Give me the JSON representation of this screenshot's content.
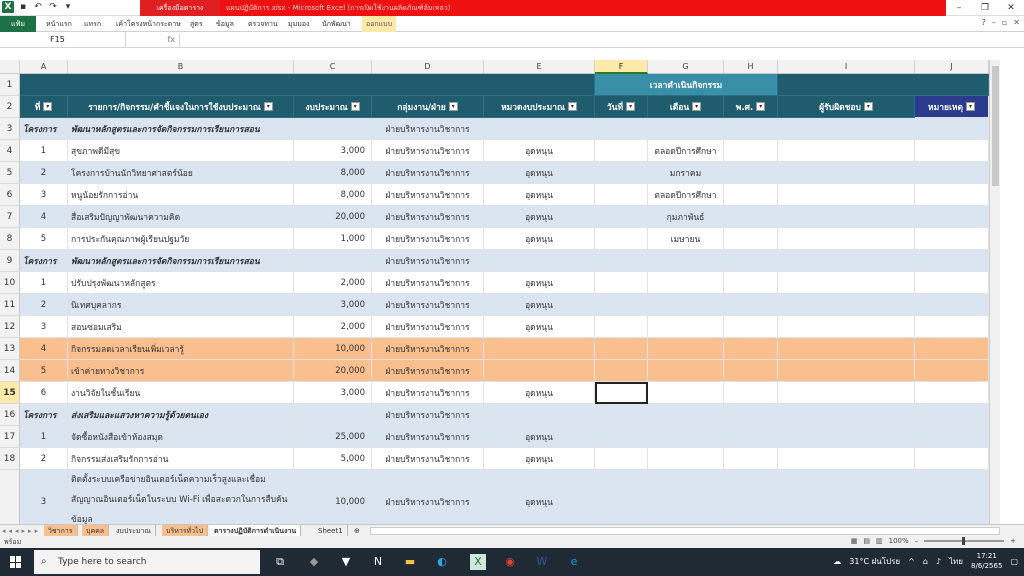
{
  "app": {
    "context_tab": "เครื่องมือตาราง",
    "window_title": "แผนปฏิบัติการ.xlsx - Microsoft Excel (การเปิดใช้งานผลิตภัณฑ์ล้มเหลว)",
    "ribbon_tabs": [
      "แฟ้ม",
      "หน้าแรก",
      "แทรก",
      "เค้าโครงหน้ากระดาษ",
      "สูตร",
      "ข้อมูล",
      "ตรวจทาน",
      "มุมมอง",
      "นักพัฒนา",
      "ออกแบบ"
    ]
  },
  "formula_bar": {
    "name_box": "F15",
    "fx": "fx",
    "value": ""
  },
  "columns": [
    "A",
    "B",
    "C",
    "D",
    "E",
    "F",
    "G",
    "H",
    "I",
    "J"
  ],
  "selected_column": "F",
  "header": {
    "group_label": "เวลาดำเนินกิจกรรม",
    "no": "ที่",
    "activity": "รายการ/กิจกรรม/คำชี้แจงในการใช้งบประมาณ",
    "budget": "งบประมาณ",
    "dept": "กลุ่มงาน/ฝ่าย",
    "category": "หมวดงบประมาณ",
    "day": "วันที่",
    "month": "เดือน",
    "year": "พ.ศ.",
    "owner": "ผู้รับผิดชอบ",
    "note": "หมายเหตุ"
  },
  "rows": [
    {
      "row": "3",
      "a": "โครงการ",
      "b": "พัฒนาหลักสูตรและการจัดกิจกรรมการเรียนการสอน",
      "c": "",
      "d": "ฝ่ายบริหารงานวิชาการ",
      "e": "",
      "g": "",
      "style": "project"
    },
    {
      "row": "4",
      "a": "1",
      "b": "สุขภาพดีมีสุข",
      "c": "3,000",
      "d": "ฝ่ายบริหารงานวิชาการ",
      "e": "อุดหนุน",
      "g": "ตลอดปีการศึกษา",
      "style": "wh"
    },
    {
      "row": "5",
      "a": "2",
      "b": "โครงการบ้านนักวิทยาศาสตร์น้อย",
      "c": "8,000",
      "d": "ฝ่ายบริหารงานวิชาการ",
      "e": "อุดหนุน",
      "g": "มกราคม",
      "style": "alt"
    },
    {
      "row": "6",
      "a": "3",
      "b": "หนูน้อยรักการอ่าน",
      "c": "8,000",
      "d": "ฝ่ายบริหารงานวิชาการ",
      "e": "อุดหนุน",
      "g": "ตลอดปีการศึกษา",
      "style": "wh"
    },
    {
      "row": "7",
      "a": "4",
      "b": "สื่อเสริมปัญญาพัฒนาความคิด",
      "c": "20,000",
      "d": "ฝ่ายบริหารงานวิชาการ",
      "e": "อุดหนุน",
      "g": "กุมภาพันธ์",
      "style": "alt"
    },
    {
      "row": "8",
      "a": "5",
      "b": "การประกันคุณภาพผู้เรียนปฐมวัย",
      "c": "1,000",
      "d": "ฝ่ายบริหารงานวิชาการ",
      "e": "อุดหนุน",
      "g": "เมษายน",
      "style": "wh"
    },
    {
      "row": "9",
      "a": "โครงการ",
      "b": "พัฒนาหลักสูตรและการจัดกิจกรรมการเรียนการสอน",
      "c": "",
      "d": "ฝ่ายบริหารงานวิชาการ",
      "e": "",
      "g": "",
      "style": "project"
    },
    {
      "row": "10",
      "a": "1",
      "b": "ปรับปรุงพัฒนาหลักสูตร",
      "c": "2,000",
      "d": "ฝ่ายบริหารงานวิชาการ",
      "e": "อุดหนุน",
      "g": "",
      "style": "wh"
    },
    {
      "row": "11",
      "a": "2",
      "b": "นิเทศบุคลากร",
      "c": "3,000",
      "d": "ฝ่ายบริหารงานวิชาการ",
      "e": "อุดหนุน",
      "g": "",
      "style": "alt"
    },
    {
      "row": "12",
      "a": "3",
      "b": "สอนซ่อมเสริม",
      "c": "2,000",
      "d": "ฝ่ายบริหารงานวิชาการ",
      "e": "อุดหนุน",
      "g": "",
      "style": "wh"
    },
    {
      "row": "13",
      "a": "4",
      "b": "กิจกรรมลดเวลาเรียนเพิ่มเวลารู้",
      "c": "10,000",
      "d": "ฝ่ายบริหารงานวิชาการ",
      "e": "",
      "g": "",
      "style": "org"
    },
    {
      "row": "14",
      "a": "5",
      "b": "เข้าค่ายทางวิชาการ",
      "c": "20,000",
      "d": "ฝ่ายบริหารงานวิชาการ",
      "e": "",
      "g": "",
      "style": "org"
    },
    {
      "row": "15",
      "a": "6",
      "b": "งานวิจัยในชั้นเรียน",
      "c": "3,000",
      "d": "ฝ่ายบริหารงานวิชาการ",
      "e": "อุดหนุน",
      "g": "",
      "style": "wh"
    },
    {
      "row": "16",
      "a": "โครงการ",
      "b": "ส่งเสริมและแสวงหาความรู้ด้วยตนเอง",
      "c": "",
      "d": "ฝ่ายบริหารงานวิชาการ",
      "e": "",
      "g": "",
      "style": "project"
    },
    {
      "row": "17",
      "a": "1",
      "b": "จัดซื้อหนังสือเข้าห้องสมุด",
      "c": "25,000",
      "d": "ฝ่ายบริหารงานวิชาการ",
      "e": "อุดหนุน",
      "g": "",
      "style": "alt"
    },
    {
      "row": "18",
      "a": "2",
      "b": "กิจกรรมส่งเสริมรักการอ่าน",
      "c": "5,000",
      "d": "ฝ่ายบริหารงานวิชาการ",
      "e": "อุดหนุน",
      "g": "",
      "style": "wh"
    },
    {
      "row": "",
      "a": "3",
      "b": "ติดตั้งระบบเครือข่ายอินเตอร์เน็ตความเร็วสูงและเชื่อมสัญญาณอินเตอร์เน็ตในระบบ Wi-Fi เพื่อสะดวกในการสืบค้นข้อมูล",
      "c": "10,000",
      "d": "ฝ่ายบริหารงานวิชาการ",
      "e": "อุดหนุน",
      "g": "",
      "style": "alt"
    }
  ],
  "sheet_tabs": [
    "วิชาการ",
    "บุคคล",
    "งบประมาณ",
    "บริหารทั่วไป",
    "ตารางปฏิบัติการดำเนินงาน",
    "Sheet1"
  ],
  "active_sheet": "ตารางปฏิบัติการดำเนินงาน",
  "status": {
    "ready": "พร้อม",
    "zoom": "100%"
  },
  "taskbar": {
    "search_placeholder": "Type here to search",
    "weather": "31°C ฝนโปรย",
    "lang": "ไทย",
    "time": "17:21",
    "date": "8/6/2565"
  }
}
